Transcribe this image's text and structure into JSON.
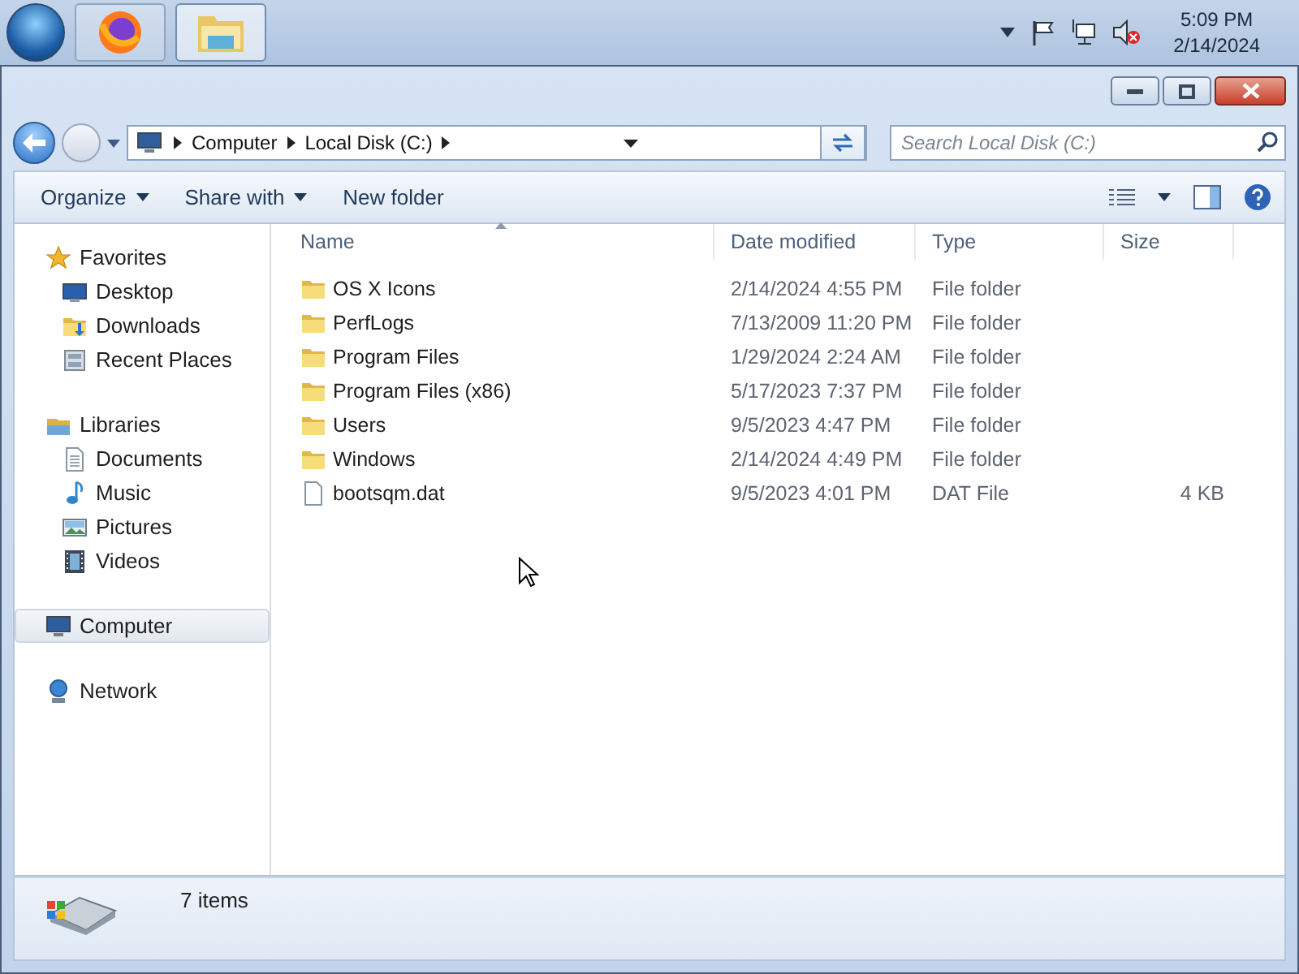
{
  "taskbar": {
    "apps": [
      {
        "kind": "browser",
        "selected": false
      },
      {
        "kind": "explorer",
        "selected": true
      }
    ],
    "clock": {
      "time": "5:09 PM",
      "date": "2/14/2024"
    }
  },
  "address": {
    "crumbs": [
      "Computer",
      "Local Disk (C:)"
    ]
  },
  "search": {
    "placeholder": "Search Local Disk (C:)"
  },
  "toolbar": {
    "commands": [
      {
        "label": "Organize",
        "dropdown": true
      },
      {
        "label": "Share with",
        "dropdown": true
      },
      {
        "label": "New folder",
        "dropdown": false
      }
    ]
  },
  "sidebar": {
    "groups": [
      {
        "label": "Favorites",
        "kind": "favorites",
        "selected": false,
        "children": [
          {
            "label": "Desktop",
            "kind": "desktop",
            "selected": false
          },
          {
            "label": "Downloads",
            "kind": "downloads",
            "selected": false
          },
          {
            "label": "Recent Places",
            "kind": "recent",
            "selected": false
          }
        ]
      },
      {
        "label": "Libraries",
        "kind": "libraries",
        "selected": false,
        "children": [
          {
            "label": "Documents",
            "kind": "documents",
            "selected": false
          },
          {
            "label": "Music",
            "kind": "music",
            "selected": false
          },
          {
            "label": "Pictures",
            "kind": "pictures",
            "selected": false
          },
          {
            "label": "Videos",
            "kind": "videos",
            "selected": false
          }
        ]
      },
      {
        "label": "Computer",
        "kind": "computer",
        "selected": true
      },
      {
        "label": "Network",
        "kind": "network",
        "selected": false
      }
    ]
  },
  "table": {
    "columns": [
      "Name",
      "Date modified",
      "Type",
      "Size"
    ],
    "rows": [
      {
        "kind": "folder",
        "name": "OS X Icons",
        "date": "2/14/2024 4:55 PM",
        "type": "File folder"
      },
      {
        "kind": "folder",
        "name": "PerfLogs",
        "date": "7/13/2009 11:20 PM",
        "type": "File folder"
      },
      {
        "kind": "folder",
        "name": "Program Files",
        "date": "1/29/2024 2:24 AM",
        "type": "File folder"
      },
      {
        "kind": "folder",
        "name": "Program Files (x86)",
        "date": "5/17/2023 7:37 PM",
        "type": "File folder"
      },
      {
        "kind": "folder",
        "name": "Users",
        "date": "9/5/2023 4:47 PM",
        "type": "File folder"
      },
      {
        "kind": "folder",
        "name": "Windows",
        "date": "2/14/2024 4:49 PM",
        "type": "File folder"
      },
      {
        "kind": "file",
        "name": "bootsqm.dat",
        "date": "9/5/2023 4:01 PM",
        "type": "DAT File",
        "size": "4 KB"
      }
    ]
  },
  "status_bar": {
    "text": "7 items"
  }
}
